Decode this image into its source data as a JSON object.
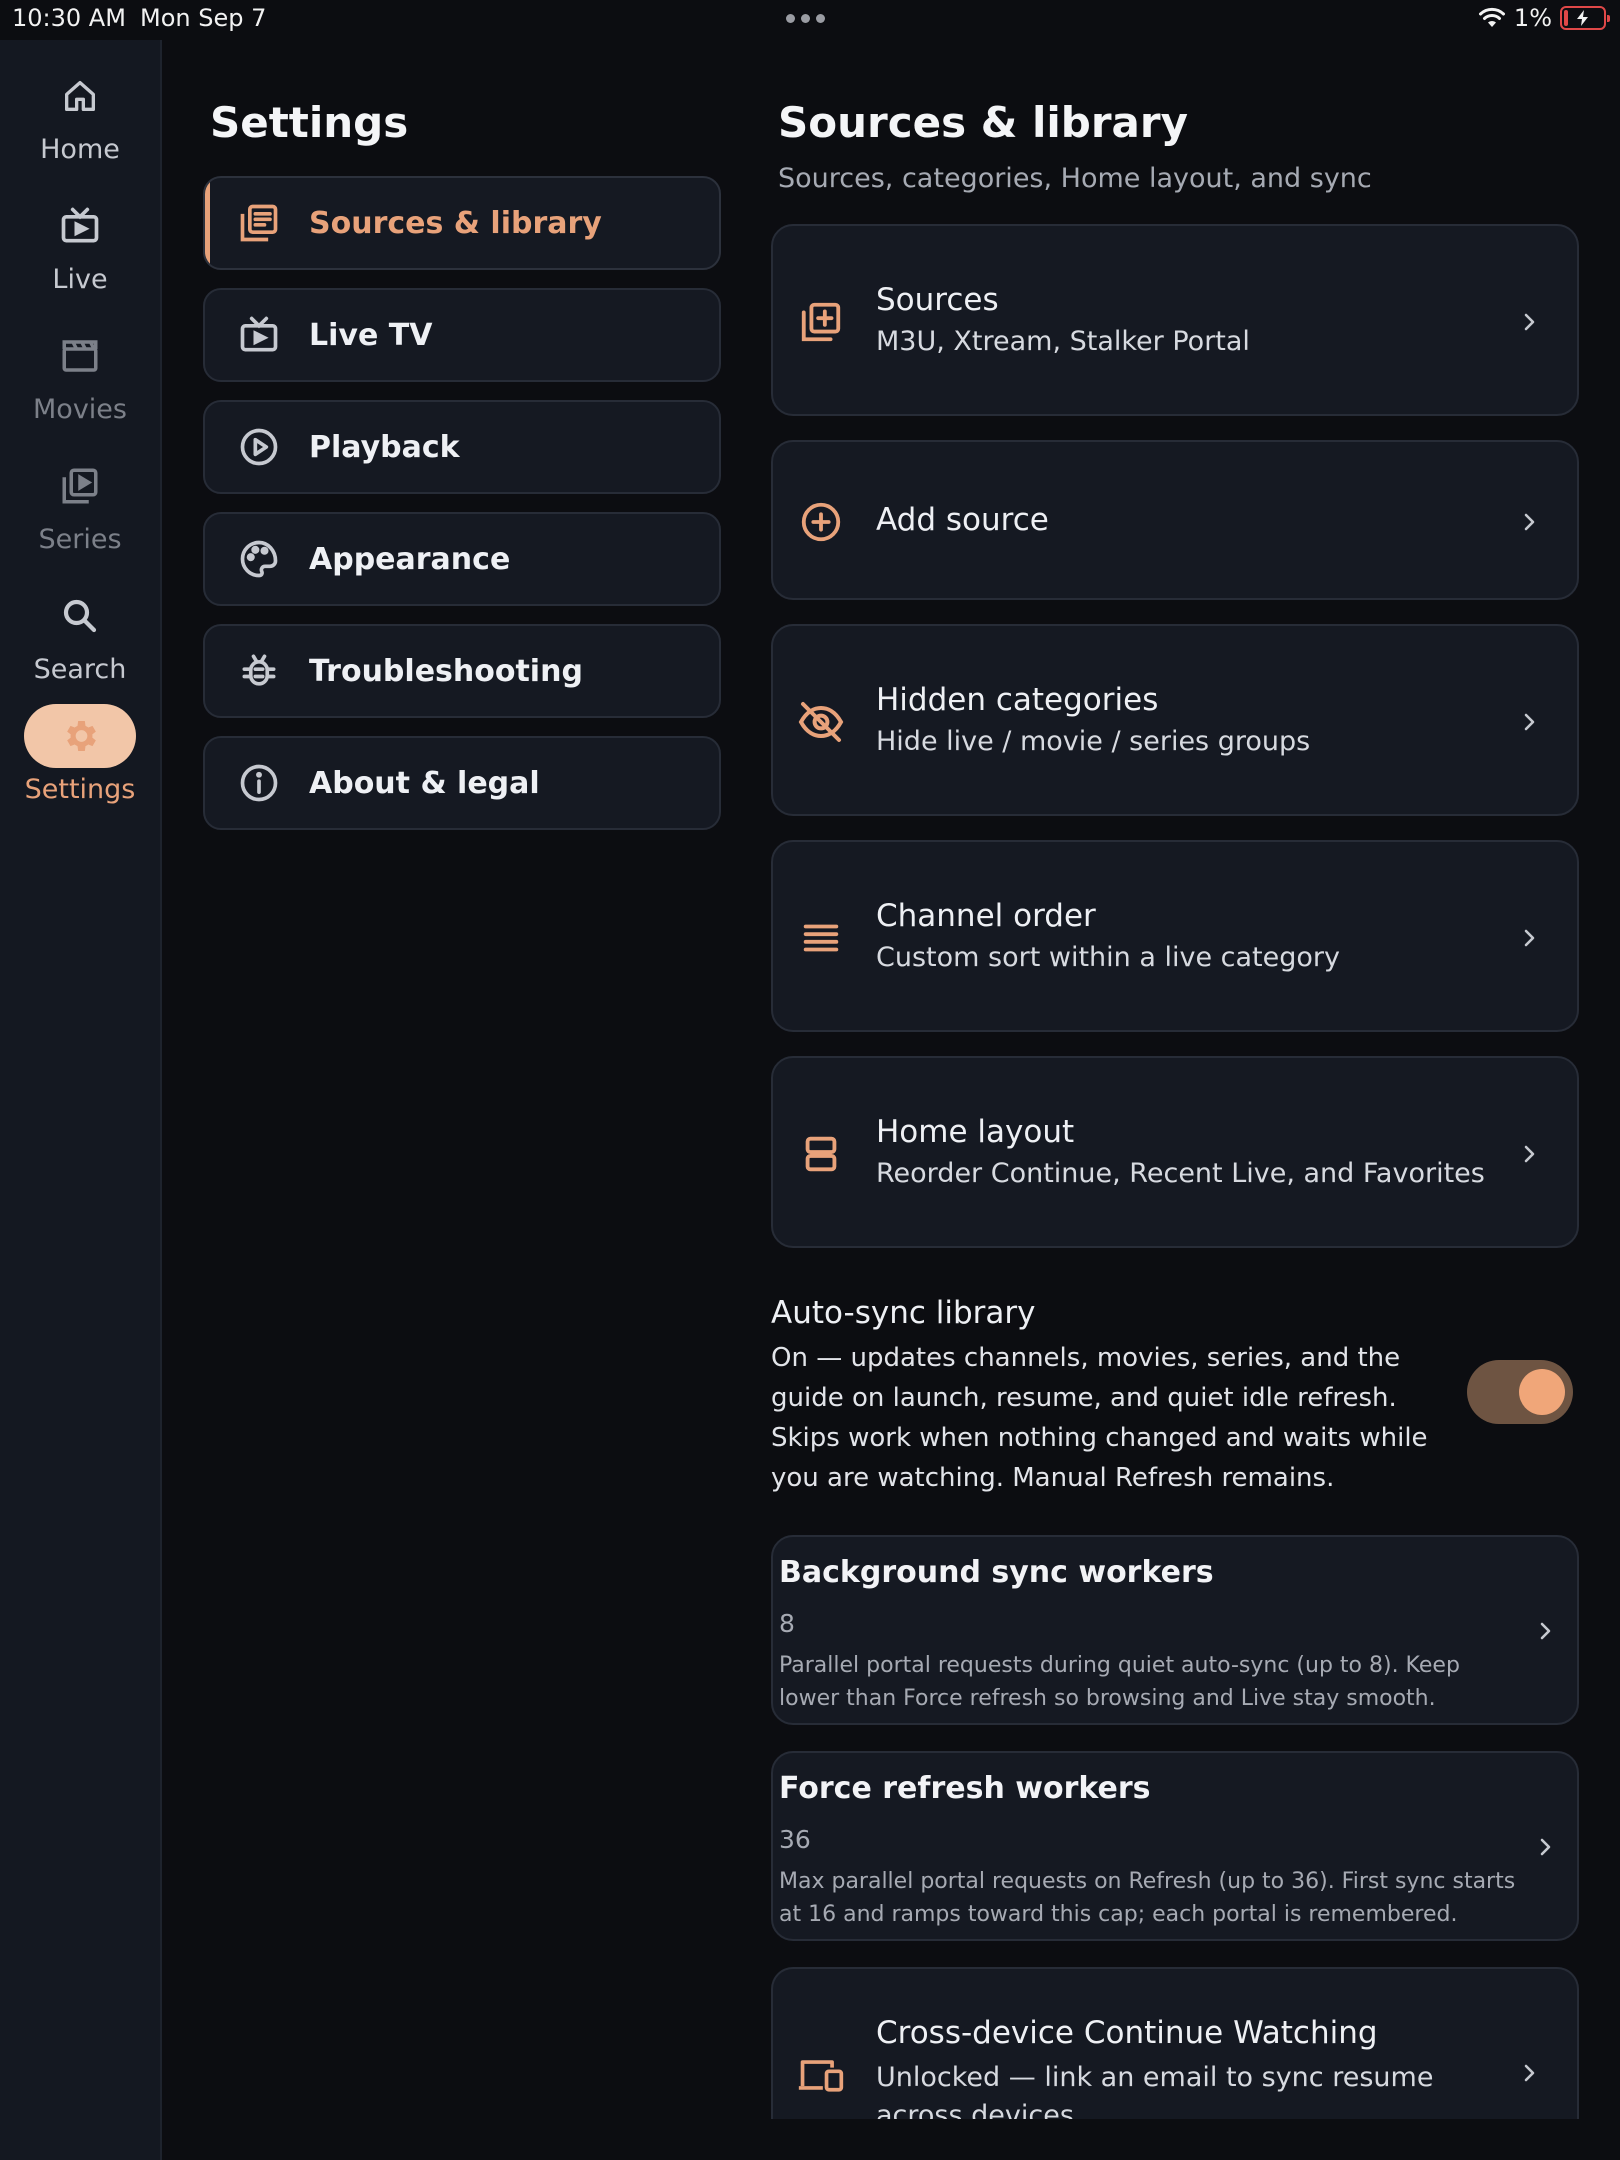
{
  "status_bar": {
    "time": "10:30 AM",
    "date": "Mon Sep 7",
    "battery": "1%"
  },
  "nav_rail": {
    "items": [
      {
        "label": "Home",
        "icon": "home-icon"
      },
      {
        "label": "Live",
        "icon": "tv-icon"
      },
      {
        "label": "Movies",
        "icon": "clapperboard-icon"
      },
      {
        "label": "Series",
        "icon": "series-icon"
      },
      {
        "label": "Search",
        "icon": "search-icon"
      },
      {
        "label": "Settings",
        "icon": "gear-icon",
        "active": true
      }
    ]
  },
  "settings": {
    "title": "Settings",
    "categories": [
      {
        "label": "Sources & library",
        "icon": "library-icon",
        "active": true
      },
      {
        "label": "Live TV",
        "icon": "tv-icon"
      },
      {
        "label": "Playback",
        "icon": "play-circle-icon"
      },
      {
        "label": "Appearance",
        "icon": "palette-icon"
      },
      {
        "label": "Troubleshooting",
        "icon": "bug-icon"
      },
      {
        "label": "About & legal",
        "icon": "info-icon"
      }
    ]
  },
  "detail": {
    "title": "Sources & library",
    "subtitle": "Sources, categories, Home layout, and sync",
    "rows": [
      {
        "title": "Sources",
        "subtitle": "M3U, Xtream, Stalker Portal",
        "icon": "add-box-icon"
      },
      {
        "title": "Add source",
        "subtitle": "",
        "icon": "add-circle-icon"
      },
      {
        "title": "Hidden categories",
        "subtitle": "Hide live / movie / series groups",
        "icon": "eye-off-icon"
      },
      {
        "title": "Channel order",
        "subtitle": "Custom sort within a live category",
        "icon": "lines-icon"
      },
      {
        "title": "Home layout",
        "subtitle": "Reorder Continue, Recent Live, and Favorites",
        "icon": "layout-icon"
      }
    ],
    "auto_sync": {
      "title": "Auto-sync library",
      "description": "On — updates channels, movies, series, and the guide on launch, resume, and quiet idle refresh. Skips work when nothing changed and waits while you are watching. Manual Refresh remains.",
      "enabled": true
    },
    "workers": [
      {
        "title": "Background sync workers",
        "value": "8",
        "description": "Parallel portal requests during quiet auto-sync (up to 8). Keep lower than Force refresh so browsing and Live stay smooth."
      },
      {
        "title": "Force refresh workers",
        "value": "36",
        "description": "Max parallel portal requests on Refresh (up to 36). First sync starts at 16 and ramps toward this cap; each portal is remembered."
      }
    ],
    "cross_device": {
      "title": "Cross-device Continue Watching",
      "subtitle": "Unlocked — link an email to sync resume across devices",
      "icon": "devices-icon"
    }
  },
  "colors": {
    "accent": "#e8a27a",
    "background": "#0c0d11",
    "card": "#151922",
    "rail": "#141821"
  }
}
